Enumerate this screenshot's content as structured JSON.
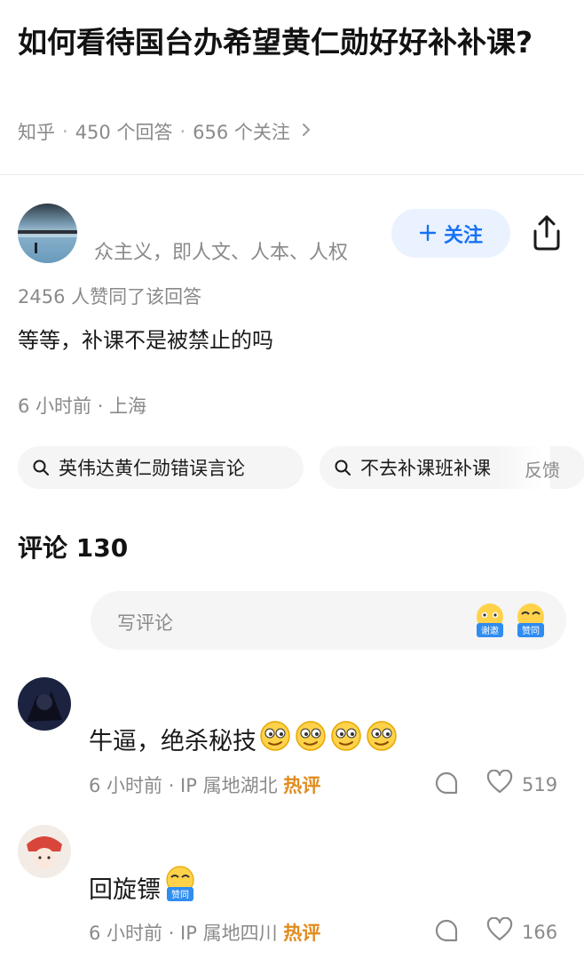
{
  "question": {
    "title": "如何看待国台办希望黄仁勋好好补补课?",
    "source": "知乎",
    "answers": "450 个回答",
    "followers": "656 个关注",
    "sep": "·"
  },
  "author": {
    "bio": "众主义，即人文、人本、人权",
    "follow_label": "关注"
  },
  "answer": {
    "votes": "2456 人赞同了该回答",
    "content": "等等，补课不是被禁止的吗",
    "time_location": "6 小时前 · 上海"
  },
  "related_searches": [
    {
      "label": "英伟达黄仁勋错误言论"
    },
    {
      "label": "不去补课班补课"
    }
  ],
  "feedback_label": "反馈",
  "comments": {
    "title": "评论 130",
    "input_placeholder": "写评论",
    "input_emojis": [
      {
        "icon": "thanks-emoji-icon",
        "label": "谢邀"
      },
      {
        "icon": "agree-emoji-icon",
        "label": "赞同"
      }
    ],
    "items": [
      {
        "text": "牛逼，绝杀秘技",
        "emoji_icons": [
          "smirk-emoji-icon",
          "smirk-emoji-icon",
          "smirk-emoji-icon",
          "smirk-emoji-icon"
        ],
        "time_location": "6 小时前 · IP 属地湖北",
        "badge": "热评",
        "likes": "519"
      },
      {
        "text": "回旋镖",
        "emoji_icons": [
          "agree-emoji-icon"
        ],
        "emoji_label": "赞同",
        "time_location": "6 小时前 · IP 属地四川",
        "badge": "热评",
        "likes": "166"
      }
    ]
  },
  "colors": {
    "accent": "#1772f6",
    "hot_badge": "#e08b1e",
    "muted_text": "#8a8a8a"
  }
}
